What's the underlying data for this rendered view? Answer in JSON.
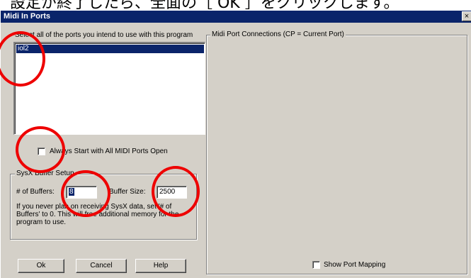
{
  "caption": "設定が終了したら、全面の［ OK ］をクリックします。",
  "window": {
    "title": "Midi In Ports",
    "close_glyph": "×"
  },
  "ports": {
    "label": "Select all of the ports you intend to use with this program",
    "items": [
      "iol2"
    ]
  },
  "always_open": {
    "label": "Always Start with All MIDI Ports Open",
    "checked": false
  },
  "sysx": {
    "group_label": "SysX Buffer Setup",
    "buffers_label": "# of Buffers:",
    "buffers_value": "8",
    "size_label": "Buffer Size:",
    "size_value": "2500",
    "info": "If you never plan on receiving SysX data, set '# of Buffers' to 0.  This will free additional memory for the program to use."
  },
  "connections": {
    "group_label": "Midi Port Connections (CP = Current Port)"
  },
  "show_mapping": {
    "label": "Show Port Mapping",
    "checked": false
  },
  "buttons": {
    "ok": "Ok",
    "cancel": "Cancel",
    "help": "Help"
  },
  "colors": {
    "titlebar": "#0a246a",
    "dialog_face": "#d4d0c8",
    "highlight": "#0a246a",
    "annotation": "#ee0000"
  }
}
